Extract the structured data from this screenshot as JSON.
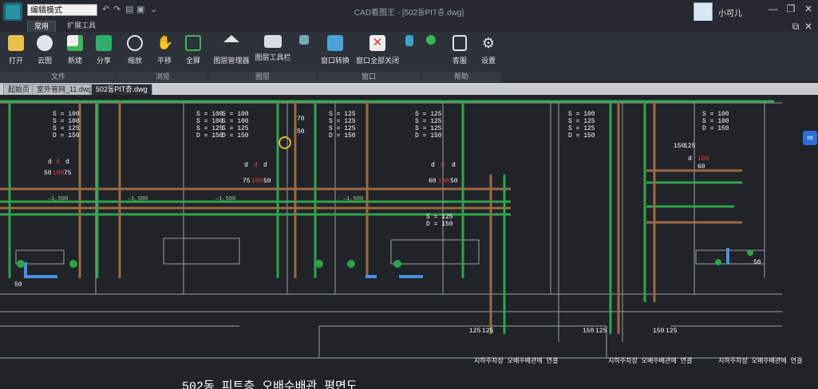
{
  "titlebar": {
    "mode_label": "编辑模式",
    "window_title": "CAD看图王 - [502동PIT층.dwg]",
    "username": "小可儿",
    "minimize": "—",
    "maximize": "❐",
    "close": "✕",
    "sub_restore": "⧉",
    "sub_close": "✕"
  },
  "ribbon_tabs": [
    "常用",
    "扩展工具"
  ],
  "tools": {
    "open": "打开",
    "cloud": "云图",
    "new": "新建",
    "share": "分享",
    "zoom": "缩放",
    "pan": "平移",
    "fullscreen": "全屏",
    "layer_manager": "图层管理器",
    "layer_toolbar": "图层工具栏",
    "window_switch": "窗口转换",
    "close_all": "窗口全部关闭",
    "support": "客服",
    "settings": "设置"
  },
  "groups": {
    "file": "文件",
    "browse": "浏览",
    "layer": "图层",
    "window": "窗口",
    "help": "帮助"
  },
  "doc_tabs": [
    "起始页",
    "室外管网_11.dwg",
    "502동PIT층.dwg"
  ],
  "drawing": {
    "labels": {
      "s100": "S = 100",
      "d150": "D = 150",
      "s125": "S = 125",
      "d_small": "d",
      "n50": "50",
      "n75": "75",
      "n100": "100",
      "n60": "60",
      "n70": "70",
      "n125": "125",
      "n150": "150",
      "dim": "—1,500"
    },
    "korean_notes": [
      "지하주차장 오배수배관에 연결",
      "지하주차장 오배수배관에 연결",
      "지하주차장 오배수배관에 연결"
    ],
    "caption": "502동 피트층 오배수배관 평면도"
  },
  "colors": {
    "green_pipe": "#2fa34a",
    "brown_pipe": "#9b6a43",
    "wall": "#9aa0a8",
    "red_label": "#e0403a"
  }
}
